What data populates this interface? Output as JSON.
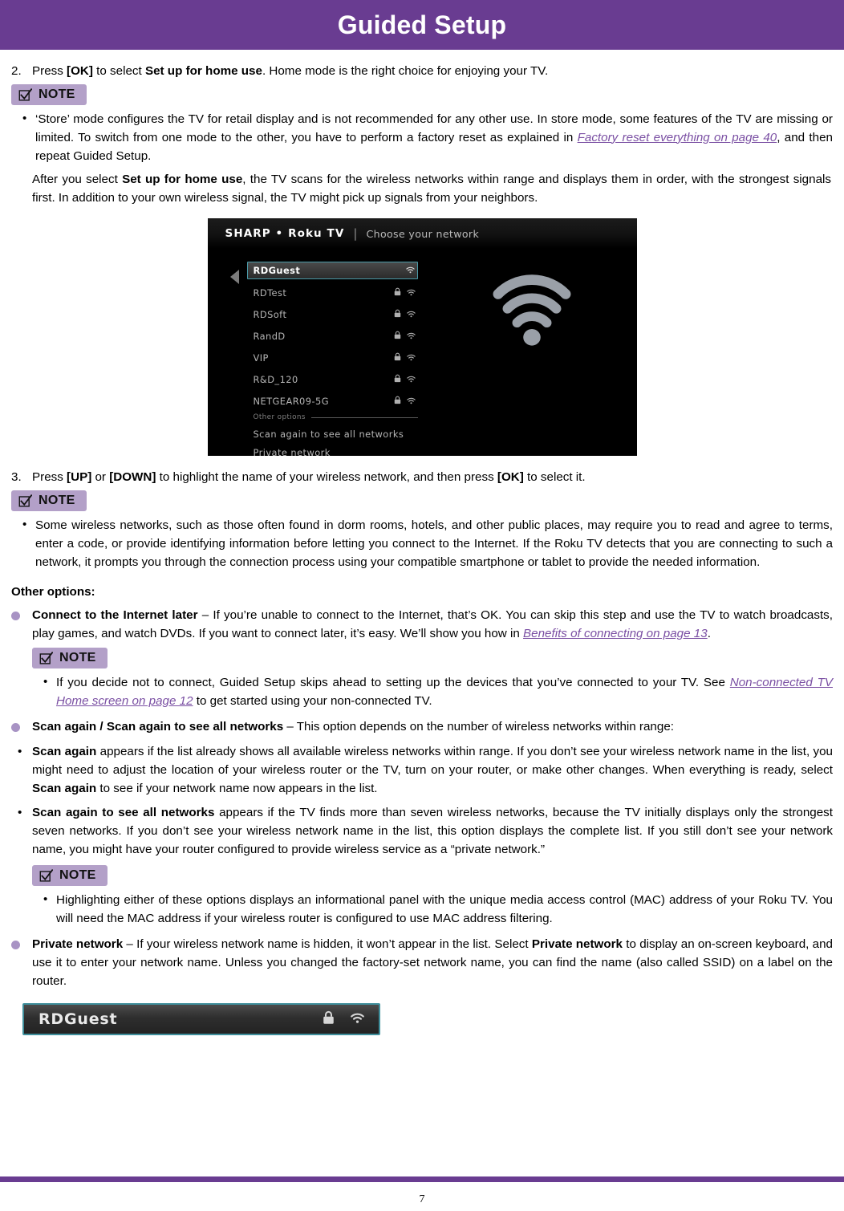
{
  "header": {
    "title": "Guided Setup"
  },
  "step2": {
    "number": "2.",
    "t1": "Press ",
    "b1": "[OK]",
    "t2": " to select ",
    "b2": "Set up for home use",
    "t3": ". Home mode is the right choice for enjoying your TV."
  },
  "note_label": "NOTE",
  "note1": {
    "bullet": "•",
    "t1": "‘Store’ mode configures the TV for retail display and is not recommended for any other use. In store mode, some features of the TV are missing or limited. To switch from one mode to the other, you have to perform a factory reset as explained in ",
    "xref": "Factory reset everything on page 40",
    "t2": ", and then repeat Guided Setup."
  },
  "para_after_note1": {
    "t1": "After you select ",
    "b1": "Set up for home use",
    "t2": ", the TV scans for the wireless networks within range and displays them in order, with the strongest signals first. In addition to your own wireless signal, the TV might pick up signals from your neighbors."
  },
  "tv_screen": {
    "brand": "SHARP • Roku TV",
    "divider": "|",
    "subtitle": "Choose your network",
    "networks": [
      {
        "name": "RDGuest",
        "selected": true,
        "lock": false,
        "wifi": true
      },
      {
        "name": "RDTest",
        "selected": false,
        "lock": true,
        "wifi": true
      },
      {
        "name": "RDSoft",
        "selected": false,
        "lock": true,
        "wifi": true
      },
      {
        "name": "RandD",
        "selected": false,
        "lock": true,
        "wifi": true
      },
      {
        "name": "VIP",
        "selected": false,
        "lock": true,
        "wifi": true
      },
      {
        "name": "R&D_120",
        "selected": false,
        "lock": true,
        "wifi": true
      },
      {
        "name": "NETGEAR09-5G",
        "selected": false,
        "lock": true,
        "wifi": true
      }
    ],
    "other_options_label": "Other options",
    "other_options": [
      "Scan again to see all networks",
      "Private network"
    ]
  },
  "step3": {
    "number": "3.",
    "t1": "Press ",
    "b1": "[UP]",
    "t2": " or ",
    "b2": "[DOWN]",
    "t3": " to highlight the name of your wireless network, and then press ",
    "b3": "[OK]",
    "t4": " to select it."
  },
  "note2": {
    "bullet": "•",
    "text": "Some wireless networks, such as those often found in dorm rooms, hotels, and other public places, may require you to read and agree to terms, enter a code, or provide identifying information before letting you connect to the Internet. If the Roku TV detects that you are connecting to such a network, it prompts you through the connection process using your compatible smartphone or tablet to provide the needed information."
  },
  "other_options_heading": "Other options:",
  "opt_connect_later": {
    "b1": "Connect to the Internet later",
    "t1": " – If you’re unable to connect to the Internet, that’s OK. You can skip this step and use the TV to watch broadcasts, play games, and watch DVDs. If you want to connect later, it’s easy. We’ll show you how in ",
    "xref": "Benefits of connecting on page 13",
    "t2": "."
  },
  "note3": {
    "bullet": "•",
    "t1": "If you decide not to connect, Guided Setup skips ahead to setting up the devices that you’ve connected to your TV. See ",
    "xref": "Non-connected TV Home screen on page 12",
    "t2": " to get started using your non-connected TV."
  },
  "opt_scan_again_header": {
    "b1": "Scan again / Scan again to see all networks",
    "t1": " – This option depends on the number of wireless networks within range:"
  },
  "sub_scan_again": {
    "bullet": "•",
    "b1": "Scan again",
    "t1": " appears if the list already shows all available wireless networks within range. If you don’t see your wireless network name in the list, you might need to adjust the location of your wireless router or the TV, turn on your router, or make other changes. When everything is ready, select ",
    "b2": "Scan again",
    "t2": " to see if your network name now appears in the list."
  },
  "sub_scan_all": {
    "bullet": "•",
    "b1": "Scan again to see all networks",
    "t1": " appears if the TV finds more than seven wireless networks, because the TV initially displays only the strongest seven networks. If you don’t see your wireless network name in the list, this option displays the complete list. If you still don’t see your network name, you might have your router configured to provide wireless service as a “private network.”"
  },
  "note4": {
    "bullet": "•",
    "text": "Highlighting either of these options displays an informational panel with the unique media access control (MAC) address of your Roku TV. You will need the MAC address if your wireless router is configured to use MAC address filtering."
  },
  "opt_private_network": {
    "b1": "Private network",
    "t1": " – If your wireless network name is hidden, it won’t appear in the list. Select ",
    "b2": "Private network",
    "t2": " to display an on-screen keyboard, and use it to enter your network name. Unless you changed the factory-set network name, you can find the name (also called SSID) on a label on the router."
  },
  "rdguest_bar": {
    "name": "RDGuest"
  },
  "footer": {
    "page_number": "7"
  },
  "colors": {
    "header_purple": "#693C91",
    "note_badge": "#B3A0C8",
    "bullet_purple": "#A893C4",
    "xref_purple": "#7a4fa3",
    "tv_select_border": "#4a9aa8"
  }
}
